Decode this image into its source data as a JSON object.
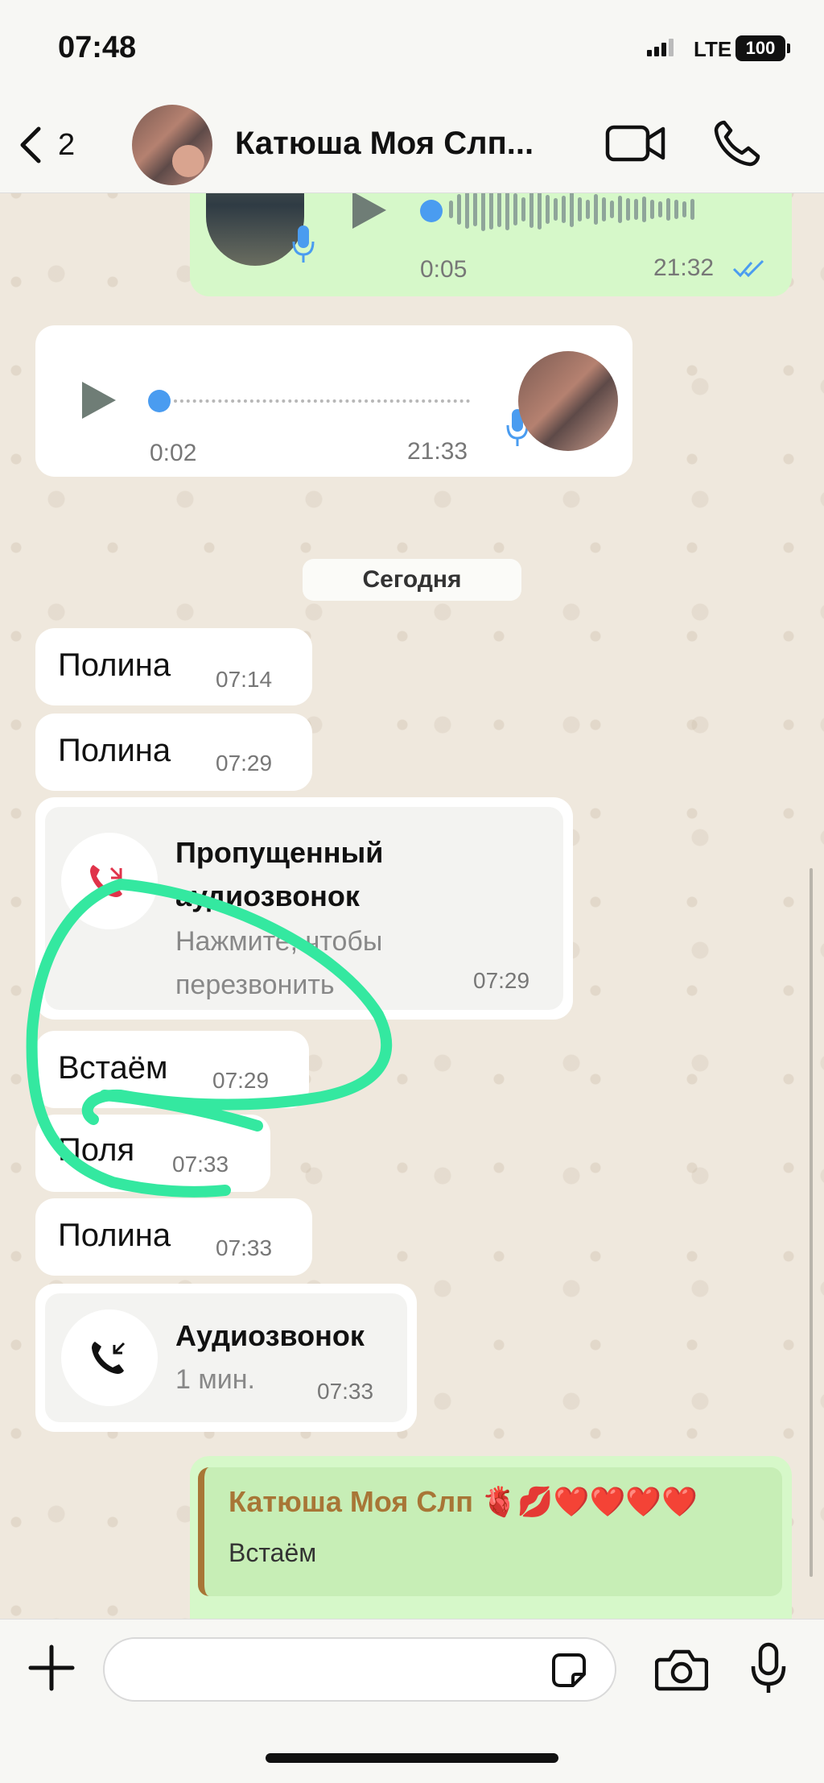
{
  "status_bar": {
    "time": "07:48",
    "network": "LTE",
    "battery": "100"
  },
  "header": {
    "back_count": "2",
    "contact_name": "Катюша Моя Слп..."
  },
  "voice_out": {
    "duration": "0:05",
    "time": "21:32"
  },
  "voice_in": {
    "duration": "0:02",
    "time": "21:33"
  },
  "date_chip": "Сегодня",
  "messages": [
    {
      "text": "Полина",
      "time": "07:14"
    },
    {
      "text": "Полина",
      "time": "07:29"
    },
    {
      "text": "Встаём",
      "time": "07:29"
    },
    {
      "text": "Поля",
      "time": "07:33"
    },
    {
      "text": "Полина",
      "time": "07:33"
    }
  ],
  "missed_call": {
    "title_line1": "Пропущенный",
    "title_line2": "аудиозвонок",
    "sub_line1": "Нажмите, чтобы",
    "sub_line2": "перезвонить",
    "time": "07:29"
  },
  "audio_call": {
    "title": "Аудиозвонок",
    "duration": "1 мин.",
    "time": "07:33"
  },
  "reply": {
    "name": "Катюша Моя Слп",
    "emoji": "🫀💋❤️❤️❤️❤️",
    "text": "Встаём"
  },
  "input": {
    "placeholder": ""
  },
  "colors": {
    "accent_green": "#34e8a0",
    "outgoing_bubble": "#d6f8c9",
    "read_tick": "#4a9cf0",
    "missed_red": "#e0334a"
  }
}
